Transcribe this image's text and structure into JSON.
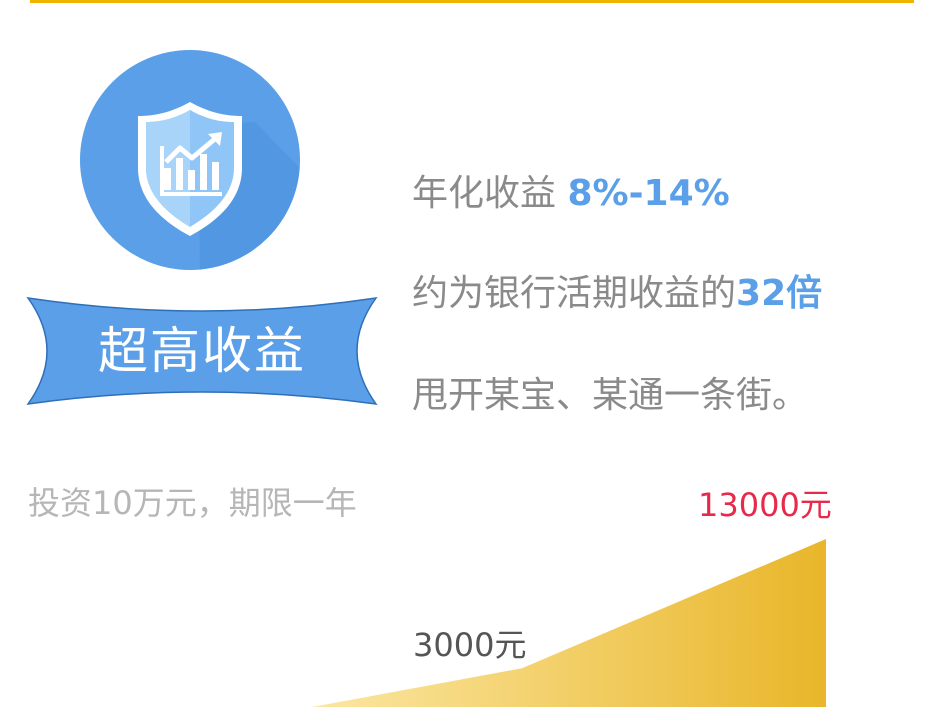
{
  "header": {
    "accent_color": "#f0b400"
  },
  "badge": {
    "icon": "shield-chart-icon",
    "color": "#5a9fe8"
  },
  "ribbon": {
    "label": "超高收益",
    "color": "#5a9fe8"
  },
  "features": {
    "f1_text": "年化收益 ",
    "f1_highlight": "8%-14%",
    "f2_text": "约为银行活期收益的",
    "f2_highlight": "32倍",
    "f3_text": "甩开某宝、某通一条街。"
  },
  "investment": {
    "note": "投资10万元，期限一年",
    "high_value": {
      "label": "13000元",
      "amount": 13000,
      "color": "#e8294a"
    },
    "low_value": {
      "label": "3000元",
      "amount": 3000
    },
    "gradient_colors": [
      "#fbe7a3",
      "#e9b62a"
    ]
  }
}
